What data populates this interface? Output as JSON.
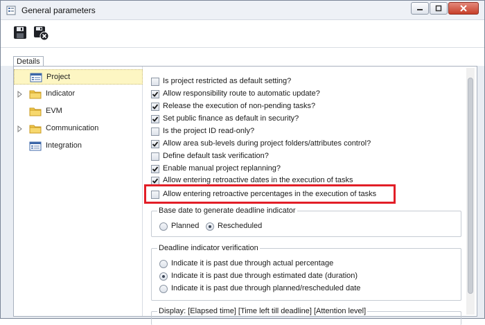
{
  "window": {
    "title": "General parameters"
  },
  "window_buttons": {
    "minimize": "minimize-icon",
    "maximize": "maximize-icon",
    "close": "close-icon"
  },
  "toolbar": {
    "save_icon": "save-icon",
    "save_close_icon": "save-and-close-icon"
  },
  "tabs": [
    {
      "label": "Details"
    }
  ],
  "sidebar": {
    "items": [
      {
        "label": "Project",
        "icon": "list-icon",
        "expandable": false,
        "selected": true
      },
      {
        "label": "Indicator",
        "icon": "folder-icon",
        "expandable": true,
        "selected": false
      },
      {
        "label": "EVM",
        "icon": "folder-icon",
        "expandable": false,
        "selected": false
      },
      {
        "label": "Communication",
        "icon": "folder-icon",
        "expandable": true,
        "selected": false
      },
      {
        "label": "Integration",
        "icon": "list-icon",
        "expandable": false,
        "selected": false
      }
    ]
  },
  "settings": {
    "checkboxes": [
      {
        "label": "Is project restricted as default setting?",
        "checked": false
      },
      {
        "label": "Allow responsibility route to automatic update?",
        "checked": true
      },
      {
        "label": "Release the execution of non-pending tasks?",
        "checked": true
      },
      {
        "label": "Set public finance as default in security?",
        "checked": true
      },
      {
        "label": "Is the project ID read-only?",
        "checked": false
      },
      {
        "label": "Allow area sub-levels during project folders/attributes control?",
        "checked": true
      },
      {
        "label": "Define default task verification?",
        "checked": false
      },
      {
        "label": "Enable manual project replanning?",
        "checked": true
      },
      {
        "label": "Allow entering retroactive dates in the execution of tasks",
        "checked": true
      },
      {
        "label": "Allow entering retroactive percentages in the execution of tasks",
        "checked": false
      }
    ],
    "base_date_group": {
      "title": "Base date to generate deadline indicator",
      "options": [
        {
          "label": "Planned",
          "selected": false
        },
        {
          "label": "Rescheduled",
          "selected": true
        }
      ]
    },
    "deadline_group": {
      "title": "Deadline indicator verification",
      "options": [
        {
          "label": "Indicate it is past due through actual percentage",
          "selected": false
        },
        {
          "label": "Indicate it is past due through estimated date (duration)",
          "selected": true
        },
        {
          "label": "Indicate it is past due through planned/rescheduled date",
          "selected": false
        }
      ]
    },
    "display_group": {
      "title": "Display: [Elapsed time] [Time left till deadline] [Attention level]"
    }
  },
  "colors": {
    "highlight": "#e21e27",
    "selected_item": "#fdf6c3",
    "close_button": "#c7402a"
  }
}
